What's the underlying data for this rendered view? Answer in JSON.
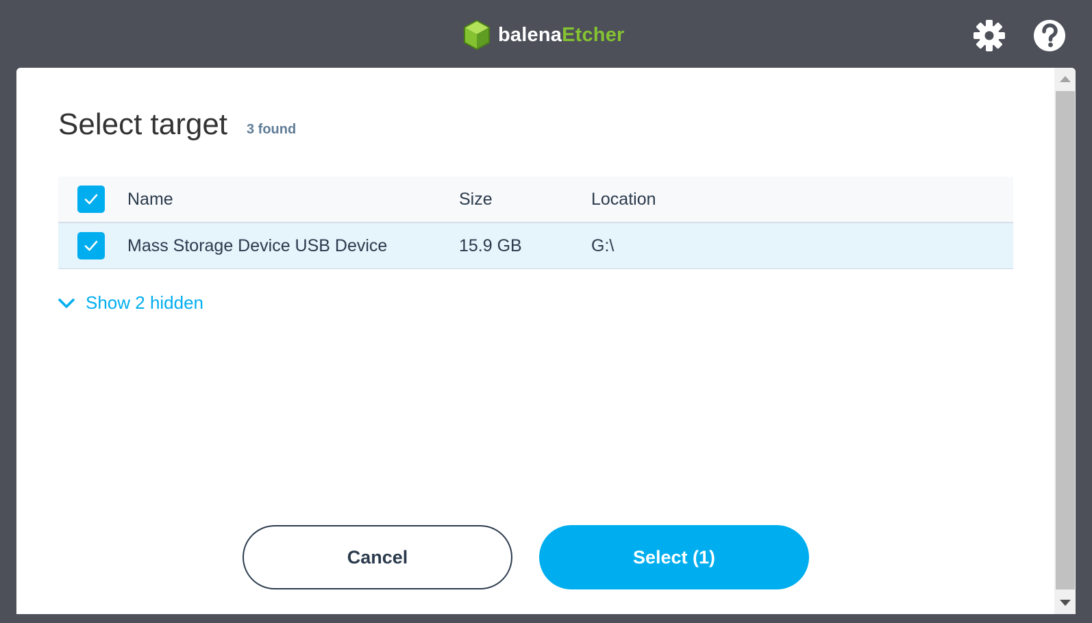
{
  "app": {
    "brand_part1": "balena",
    "brand_part2": "Etcher",
    "brand_colors": {
      "white": "#ffffff",
      "green": "#85c232"
    },
    "settings_icon": "gear-icon",
    "help_icon": "help-icon"
  },
  "modal": {
    "title": "Select target",
    "found_count": "3 found",
    "table": {
      "headers": {
        "name": "Name",
        "size": "Size",
        "location": "Location"
      },
      "rows": [
        {
          "name": "Mass Storage Device USB Device",
          "size": "15.9 GB",
          "location": "G:\\",
          "checked": true
        }
      ]
    },
    "show_hidden": "Show 2 hidden",
    "cancel_label": "Cancel",
    "select_label": "Select (1)"
  },
  "colors": {
    "accent": "#00aeef",
    "text": "#2a3a4c",
    "chrome": "#4d5059"
  }
}
